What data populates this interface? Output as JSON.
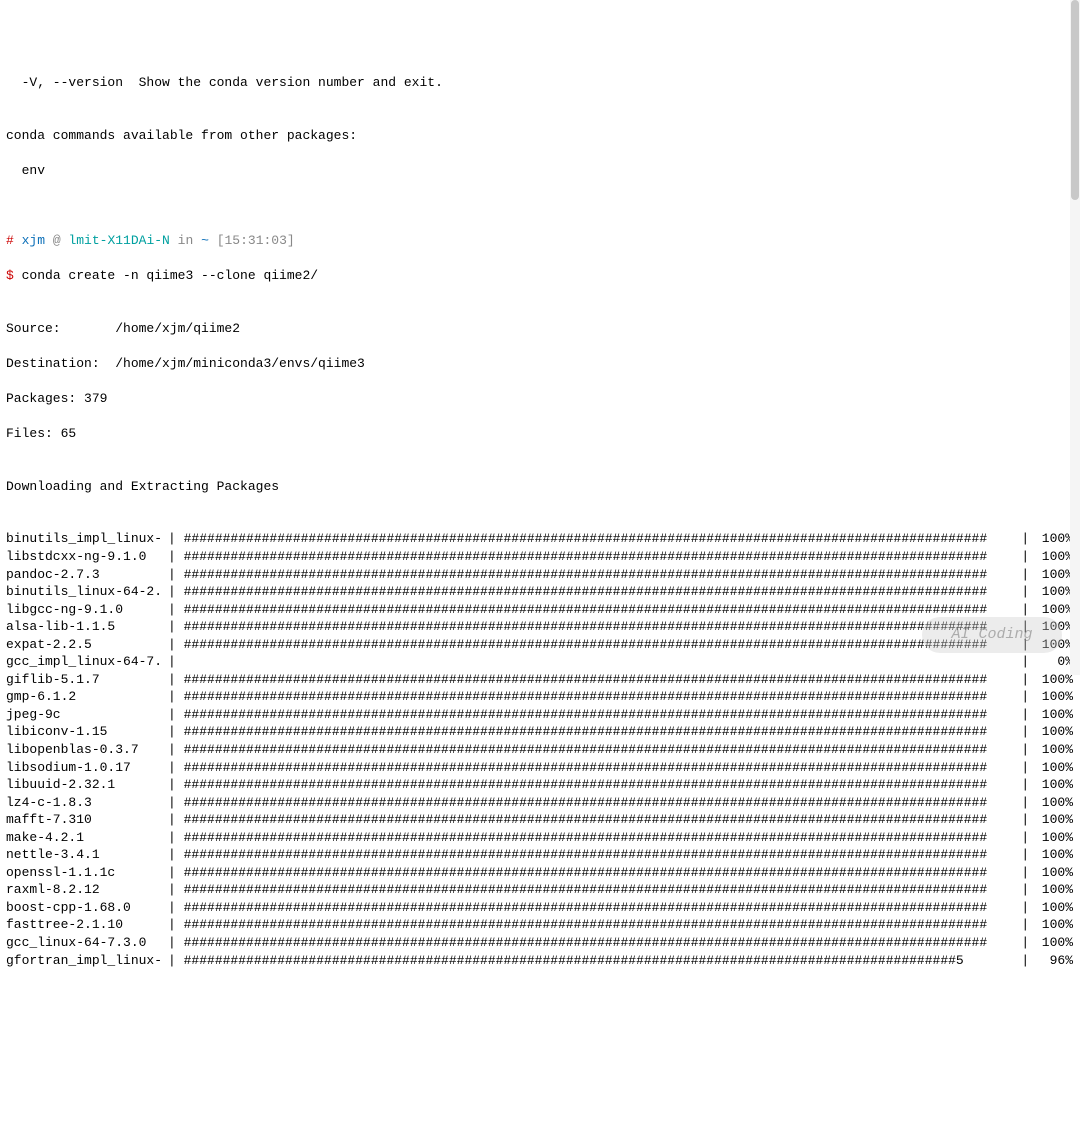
{
  "header": {
    "option_line": "  -V, --version  Show the conda version number and exit.",
    "blank1": "",
    "commands_avail": "conda commands available from other packages:",
    "env_line": "  env",
    "blank2": ""
  },
  "prompt": {
    "hash": "#",
    "user": "xjm",
    "at": " @ ",
    "host": "lmit-X11DAi-N",
    "in_text": " in ",
    "path": "~",
    "time": " [15:31:03]",
    "dollar": "$",
    "command": " conda create -n qiime3 --clone qiime2/"
  },
  "output": {
    "source": "Source:       /home/xjm/qiime2",
    "destination": "Destination:  /home/xjm/miniconda3/envs/qiime3",
    "packages": "Packages: 379",
    "files": "Files: 65",
    "blank": "",
    "section_header": "Downloading and Extracting Packages"
  },
  "packages": [
    {
      "name": "binutils_impl_linux-",
      "pct": "100%",
      "fill": 100
    },
    {
      "name": "libstdcxx-ng-9.1.0",
      "pct": "100%",
      "fill": 100
    },
    {
      "name": "pandoc-2.7.3",
      "pct": "100%",
      "fill": 100
    },
    {
      "name": "binutils_linux-64-2.",
      "pct": "100%",
      "fill": 100
    },
    {
      "name": "libgcc-ng-9.1.0",
      "pct": "100%",
      "fill": 100
    },
    {
      "name": "alsa-lib-1.1.5",
      "pct": "100%",
      "fill": 100
    },
    {
      "name": "expat-2.2.5",
      "pct": "100%",
      "fill": 100
    },
    {
      "name": "gcc_impl_linux-64-7.",
      "pct": "0%",
      "fill": 0
    },
    {
      "name": "giflib-5.1.7",
      "pct": "100%",
      "fill": 100
    },
    {
      "name": "gmp-6.1.2",
      "pct": "100%",
      "fill": 100
    },
    {
      "name": "jpeg-9c",
      "pct": "100%",
      "fill": 100
    },
    {
      "name": "libiconv-1.15",
      "pct": "100%",
      "fill": 100
    },
    {
      "name": "libopenblas-0.3.7",
      "pct": "100%",
      "fill": 100
    },
    {
      "name": "libsodium-1.0.17",
      "pct": "100%",
      "fill": 100
    },
    {
      "name": "libuuid-2.32.1",
      "pct": "100%",
      "fill": 100
    },
    {
      "name": "lz4-c-1.8.3",
      "pct": "100%",
      "fill": 100
    },
    {
      "name": "mafft-7.310",
      "pct": "100%",
      "fill": 100
    },
    {
      "name": "make-4.2.1",
      "pct": "100%",
      "fill": 100
    },
    {
      "name": "nettle-3.4.1",
      "pct": "100%",
      "fill": 100
    },
    {
      "name": "openssl-1.1.1c",
      "pct": "100%",
      "fill": 100
    },
    {
      "name": "raxml-8.2.12",
      "pct": "100%",
      "fill": 100
    },
    {
      "name": "boost-cpp-1.68.0",
      "pct": "100%",
      "fill": 100
    },
    {
      "name": "fasttree-2.1.10",
      "pct": "100%",
      "fill": 100
    },
    {
      "name": "gcc_linux-64-7.3.0",
      "pct": "100%",
      "fill": 100
    },
    {
      "name": "gfortran_impl_linux-",
      "pct": "96%",
      "fill": 96
    }
  ],
  "watermark_text": "AI Coding"
}
